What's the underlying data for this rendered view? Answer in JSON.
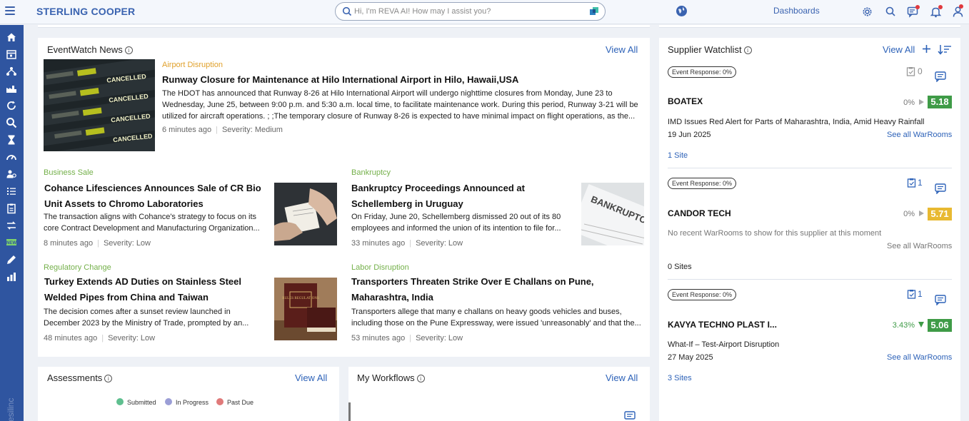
{
  "header": {
    "brand": "STERLING COOPER",
    "search_placeholder": "Hi, I'm REVA AI! How may I assist you?",
    "dashboards_label": "Dashboards",
    "icons": [
      "menu-icon",
      "search-icon",
      "reva-icon",
      "globe-icon",
      "settings-gear-icon",
      "search-icon",
      "messages-icon",
      "bell-icon",
      "user-icon"
    ]
  },
  "sidebar": {
    "items": [
      "home-icon",
      "calendar-icon",
      "network-icon",
      "factory-icon",
      "refresh-icon",
      "search-icon",
      "hourglass-icon",
      "gauge-icon",
      "users-icon",
      "list-icon",
      "clipboard-icon",
      "transfer-icon",
      "new-icon",
      "edit-icon",
      "report-icon"
    ],
    "watermark": "resilinc"
  },
  "news": {
    "title": "EventWatch News",
    "view_all": "View All",
    "featured": {
      "category": "Airport Disruption",
      "headline": "Runway Closure for Maintenance at Hilo International Airport in Hilo, Hawaii,USA",
      "excerpt": "The HDOT has announced that Runway 8-26 at Hilo International Airport will undergo nighttime closures from Monday, June 23 to Wednesday, June 25, between 9:00 p.m. and 5:30 a.m. local time, to facilitate maintenance work. During this period, Runway 3-21 will be utilized for aircraft operations. ; ;The temporary closure of Runway 8-26 is expected to have minimal impact on flight operations, as the...",
      "time": "6 minutes ago",
      "severity": "Severity: Medium",
      "board": [
        "CANCELLED",
        "CANCELLED",
        "CANCELLED",
        "CANCELLED"
      ]
    },
    "items": [
      {
        "category": "Business Sale",
        "headline": "Cohance Lifesciences Announces Sale of CR Bio Unit Assets to Chromo Laboratories",
        "excerpt": "The transaction aligns with Cohance's strategy to focus on its core Contract Development and Manufacturing Organization...",
        "time": "8 minutes ago",
        "severity": "Severity: Low"
      },
      {
        "category": "Bankruptcy",
        "headline": "Bankruptcy Proceedings Announced at Schellemberg in Uruguay",
        "excerpt": "On Friday, June 20, Schellemberg dismissed 20 out of its 80 employees and informed the union of its intention to file for...",
        "time": "33 minutes ago",
        "severity": "Severity: Low",
        "image_text": "BANKRUPTCY"
      },
      {
        "category": "Regulatory Change",
        "headline": "Turkey Extends AD Duties on Stainless Steel Welded Pipes from China and Taiwan",
        "excerpt": "The decision comes after a sunset review launched in December 2023 by the Ministry of Trade, prompted by an...",
        "time": "48 minutes ago",
        "severity": "Severity: Low",
        "image_text": "RULES REGULATIONS"
      },
      {
        "category": "Labor Disruption",
        "headline": "Transporters Threaten Strike Over E Challans on Pune, Maharashtra, India",
        "excerpt": "Transporters allege that many e challans on heavy goods vehicles and buses, including those on the Pune Expressway, were issued 'unreasonably' and that the...",
        "time": "53 minutes ago",
        "severity": "Severity: Low"
      }
    ]
  },
  "watchlist": {
    "title": "Supplier Watchlist",
    "view_all": "View All",
    "suppliers": [
      {
        "event_response": "Event Response: 0%",
        "tasks": "0",
        "name": "BOATEX",
        "pct": "0%",
        "trend": "flat",
        "score": "5.18",
        "score_color": "#3f9b47",
        "event": "IMD Issues Red Alert for Parts of Maharashtra, India, Amid Heavy Rainfall",
        "date": "19 Jun 2025",
        "see_all": "See all WarRooms",
        "sites": "1 Site"
      },
      {
        "event_response": "Event Response: 0%",
        "tasks": "1",
        "name": "CANDOR TECH",
        "pct": "0%",
        "trend": "flat",
        "score": "5.71",
        "score_color": "#e8b931",
        "event": "No recent WarRooms to show for this supplier at this moment",
        "date": "",
        "see_all": "See all WarRooms",
        "sites": "0 Sites"
      },
      {
        "event_response": "Event Response: 0%",
        "tasks": "1",
        "name": "KAVYA TECHNO PLAST I...",
        "pct": "3.43%",
        "trend": "down",
        "score": "5.06",
        "score_color": "#3f9b47",
        "event": "What-If – Test-Airport Disruption",
        "date": "27 May 2025",
        "see_all": "See all WarRooms",
        "sites": "3 Sites"
      }
    ]
  },
  "assessments": {
    "title": "Assessments",
    "view_all": "View All",
    "legend": [
      {
        "label": "Submitted",
        "color": "#5fbf8f"
      },
      {
        "label": "In Progress",
        "color": "#9b9ed6"
      },
      {
        "label": "Past Due",
        "color": "#e07a7a"
      }
    ]
  },
  "workflows": {
    "title": "My Workflows",
    "view_all": "View All"
  }
}
